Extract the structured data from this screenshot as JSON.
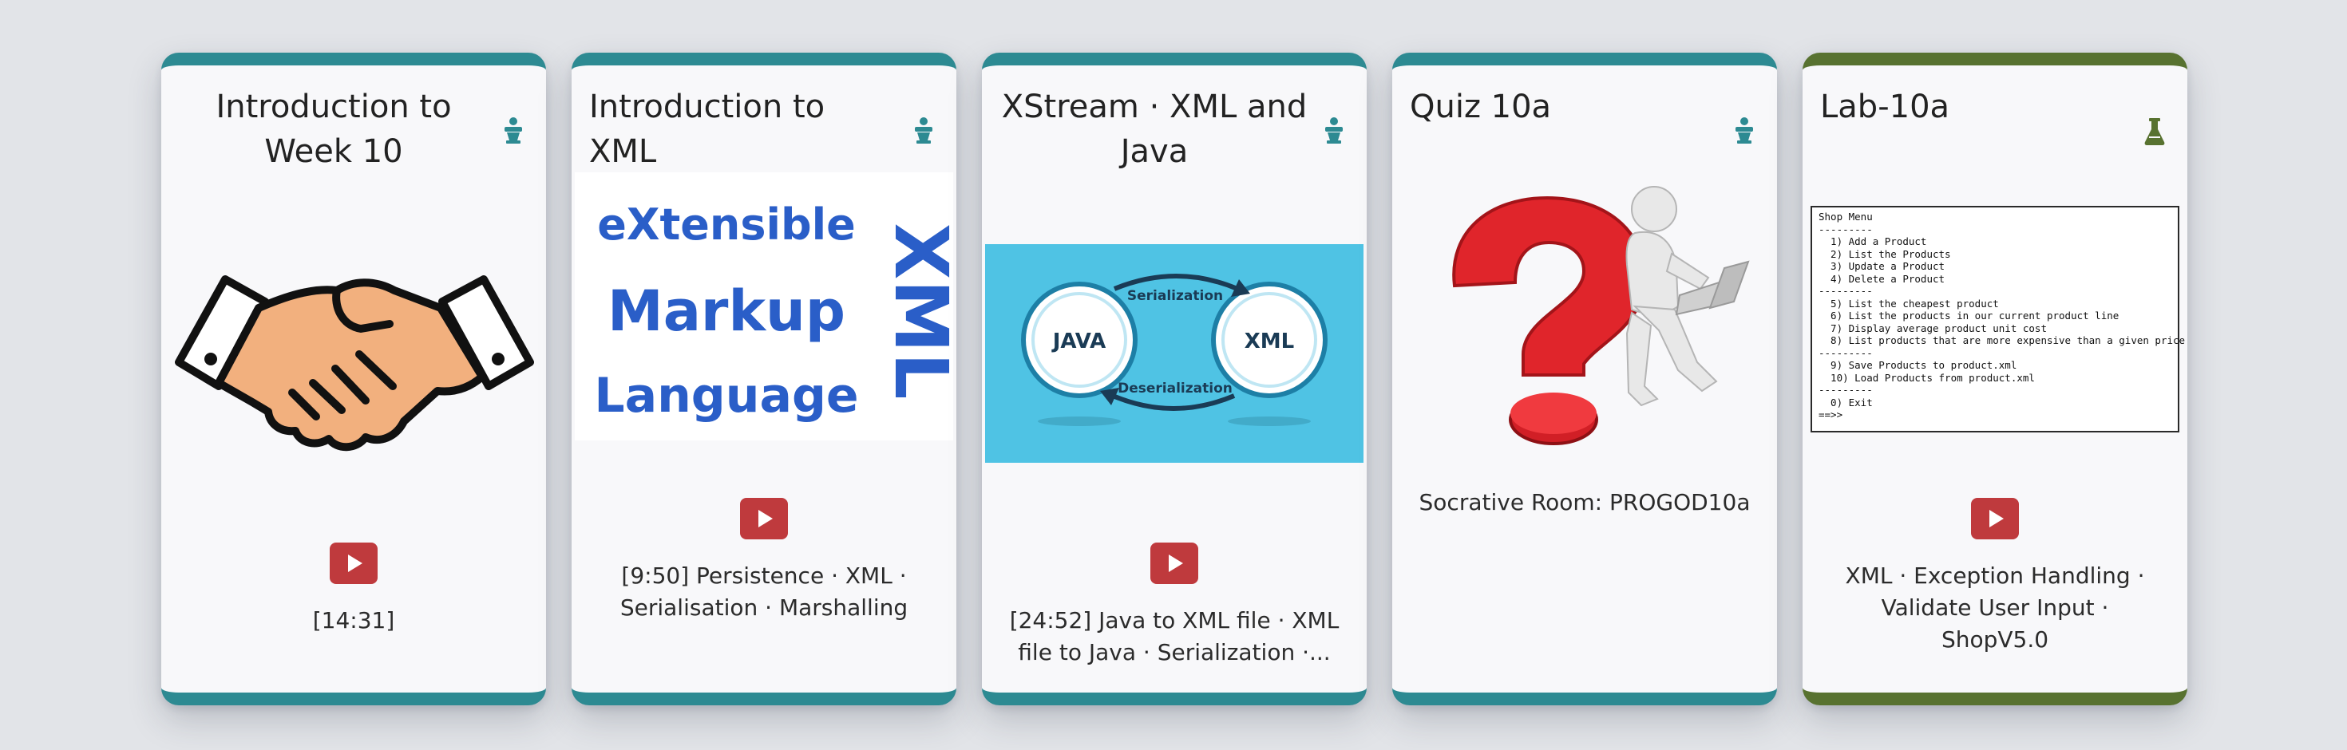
{
  "cards": [
    {
      "title": "Introduction to Week 10",
      "icon": "lecture-icon",
      "image": "handshake",
      "caption": "[14:31]",
      "accent": "#2d8a92"
    },
    {
      "title": "Introduction to XML",
      "icon": "lecture-icon",
      "image": "xml-logo",
      "image_text": {
        "line1": "eXtensible",
        "line2": "Markup",
        "line3": "Language",
        "side": "XML"
      },
      "caption": "[9:50] Persistence · XML · Serialisation · Marshalling",
      "accent": "#2d8a92"
    },
    {
      "title": "XStream · XML and Java",
      "icon": "lecture-icon",
      "image": "serialization-diagram",
      "image_text": {
        "left": "JAVA",
        "right": "XML",
        "top": "Serialization",
        "bottom": "Deserialization"
      },
      "caption": "[24:52] Java to XML file · XML file to Java · Serialization ·...",
      "accent": "#2d8a92"
    },
    {
      "title": "Quiz 10a",
      "icon": "lecture-icon",
      "image": "question-mark-figure",
      "caption": "Socrative Room: PROGOD10a",
      "accent": "#2d8a92"
    },
    {
      "title": "Lab-10a",
      "icon": "flask-icon",
      "image": "shop-menu-console",
      "terminal_lines": [
        "Shop Menu",
        "---------",
        "  1) Add a Product",
        "  2) List the Products",
        "  3) Update a Product",
        "  4) Delete a Product",
        "---------",
        "  5) List the cheapest product",
        "  6) List the products in our current product line",
        "  7) Display average product unit cost",
        "  8) List products that are more expensive than a given price",
        "---------",
        "  9) Save Products to product.xml",
        "  10) Load Products from product.xml",
        "---------",
        "  0) Exit",
        "==>>"
      ],
      "caption": "XML · Exception Handling · Validate User Input · ShopV5.0",
      "accent": "#587230"
    }
  ]
}
